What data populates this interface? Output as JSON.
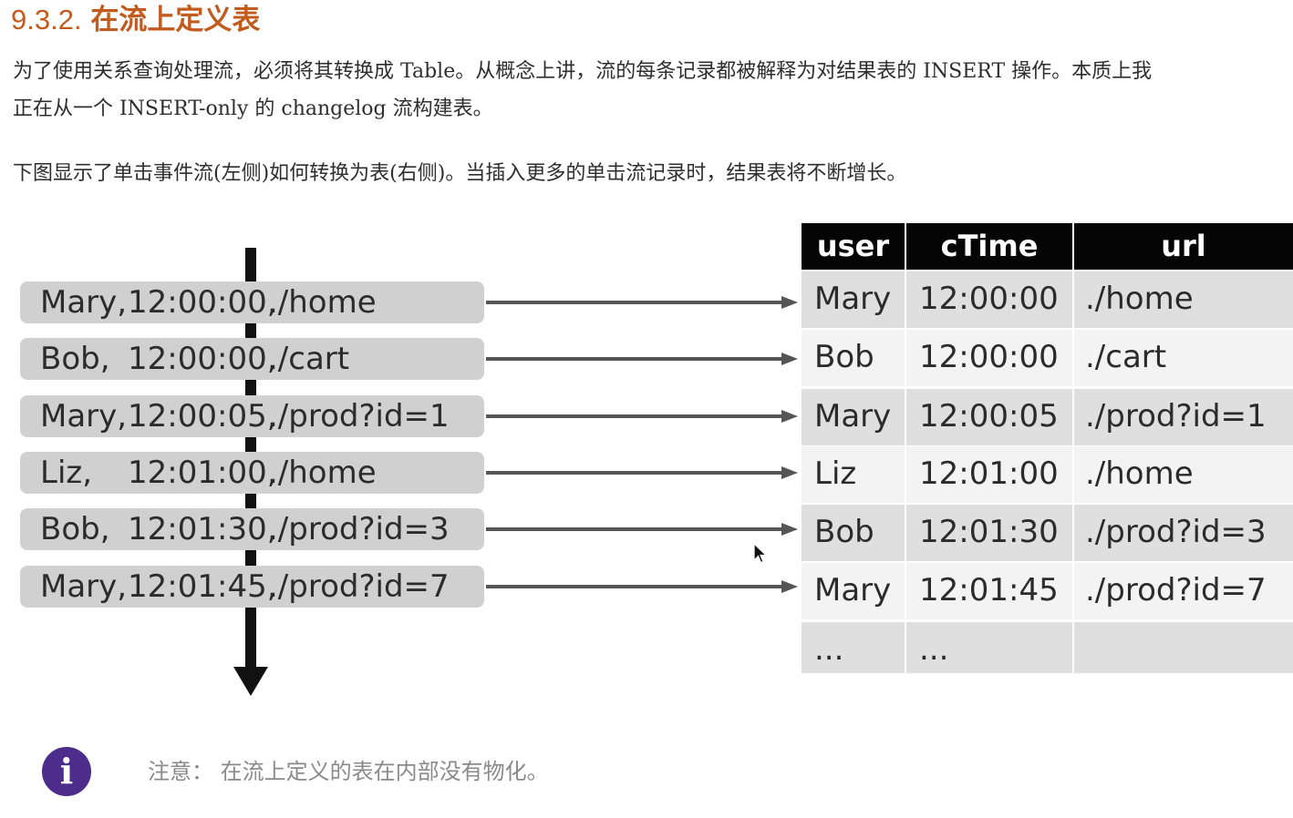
{
  "section": {
    "number": "9.3.2.",
    "title": "在流上定义表"
  },
  "paragraphs": {
    "p1_line1": "为了使用关系查询处理流，必须将其转换成 Table。从概念上讲，流的每条记录都被解释为对结果表的 INSERT 操作。本质上我",
    "p1_line2": "正在从一个 INSERT-only 的 changelog 流构建表。",
    "p2": "下图显示了单击事件流(左侧)如何转换为表(右侧)。当插入更多的单击流记录时，结果表将不断增长。"
  },
  "diagram": {
    "events": [
      {
        "user": "Mary,",
        "time": "12:00:00,",
        "url": "./home"
      },
      {
        "user": "Bob,",
        "time": "12:00:00,",
        "url": "./cart"
      },
      {
        "user": "Mary,",
        "time": "12:00:05,",
        "url": "./prod?id=1"
      },
      {
        "user": "Liz,",
        "time": "12:01:00,",
        "url": "./home"
      },
      {
        "user": "Bob,",
        "time": "12:01:30,",
        "url": "./prod?id=3"
      },
      {
        "user": "Mary,",
        "time": "12:01:45,",
        "url": "./prod?id=7"
      }
    ],
    "table": {
      "headers": [
        "user",
        "cTime",
        "url"
      ],
      "rows": [
        [
          "Mary",
          "12:00:00",
          "./home"
        ],
        [
          "Bob",
          "12:00:00",
          "./cart"
        ],
        [
          "Mary",
          "12:00:05",
          "./prod?id=1"
        ],
        [
          "Liz",
          "12:01:00",
          "./home"
        ],
        [
          "Bob",
          "12:01:30",
          "./prod?id=3"
        ],
        [
          "Mary",
          "12:01:45",
          "./prod?id=7"
        ],
        [
          "...",
          "...",
          ""
        ]
      ]
    }
  },
  "note": {
    "icon": "info-icon",
    "text": "注意： 在流上定义的表在内部没有物化。"
  },
  "colors": {
    "heading": "#c25b1e",
    "table_header": "#050505",
    "info_icon": "#4d2d8c"
  }
}
